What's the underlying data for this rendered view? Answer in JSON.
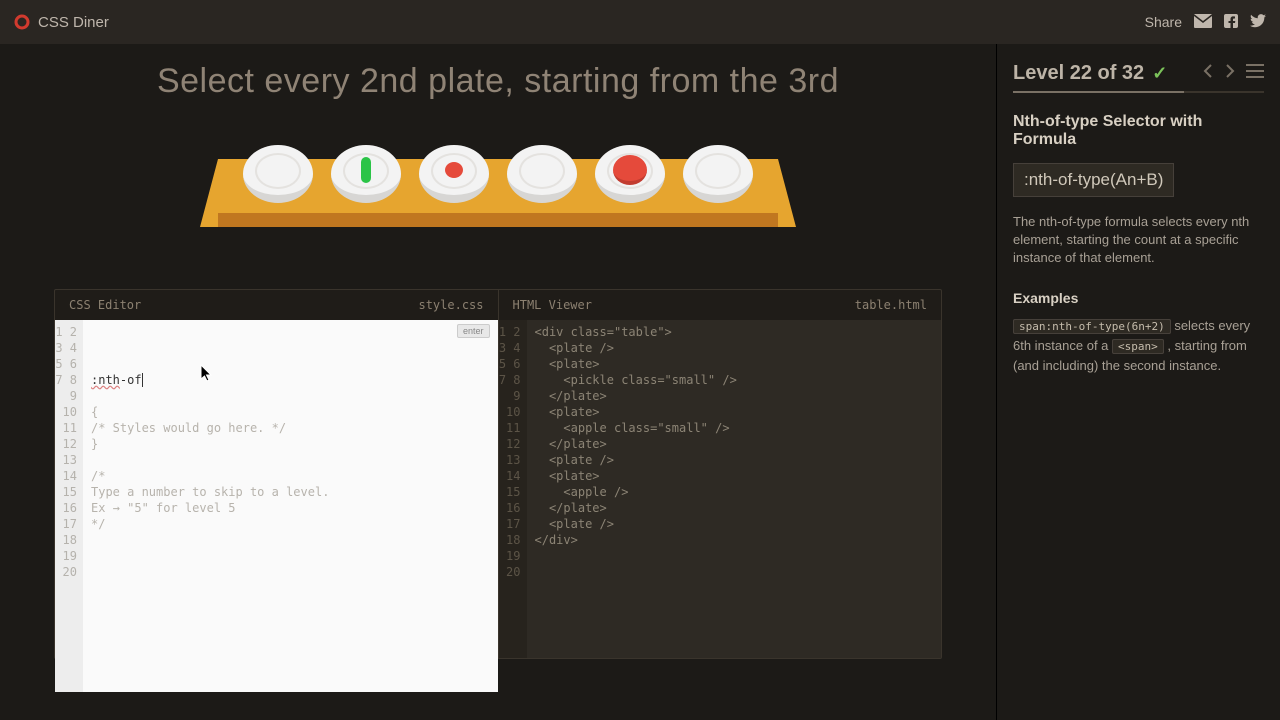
{
  "brand": "CSS Diner",
  "share_label": "Share",
  "game_title": "Select every 2nd plate, starting from the 3rd",
  "css_editor": {
    "header_left": "CSS Editor",
    "header_right": "style.css",
    "input_value": ":nth-of",
    "enter_label": "enter",
    "lines": [
      "",
      "{",
      "/* Styles would go here. */",
      "}",
      "",
      "/*",
      "Type a number to skip to a level.",
      "Ex → \"5\" for level 5",
      "*/"
    ]
  },
  "html_viewer": {
    "header_left": "HTML Viewer",
    "header_right": "table.html",
    "lines": [
      "<div class=\"table\">",
      "  <plate />",
      "  <plate>",
      "    <pickle class=\"small\" />",
      "  </plate>",
      "  <plate>",
      "    <apple class=\"small\" />",
      "  </plate>",
      "  <plate />",
      "  <plate>",
      "    <apple />",
      "  </plate>",
      "  <plate />",
      "</div>"
    ]
  },
  "level": {
    "text": "Level 22 of 32",
    "lesson_title": "Nth-of-type Selector with Formula",
    "selector": ":nth-of-type(An+B)",
    "description": "The nth-of-type formula selects every nth element, starting the count at a specific instance of that element.",
    "examples_heading": "Examples",
    "example_code": "span:nth-of-type(6n+2)",
    "example_pre": " selects every 6th instance of a ",
    "example_tag": "<span>",
    "example_post": " , starting from (and including) the second instance."
  }
}
